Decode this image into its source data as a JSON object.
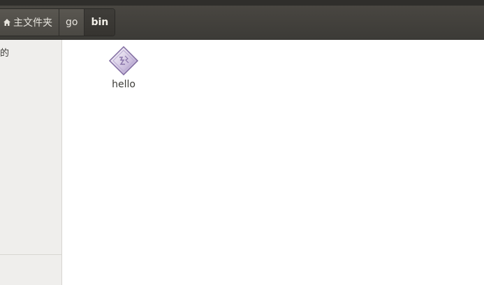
{
  "breadcrumb": {
    "items": [
      {
        "label": "主文件夹",
        "icon": "home-icon"
      },
      {
        "label": "go"
      },
      {
        "label": "bin",
        "active": true
      }
    ]
  },
  "sidebar": {
    "items": [
      {
        "label": "的"
      }
    ]
  },
  "files": [
    {
      "name": "hello",
      "icon": "executable-icon"
    }
  ],
  "colors": {
    "toolbar": "#3c3b37",
    "sidebar": "#efeeec",
    "icon_accent": "#9b86b8"
  }
}
